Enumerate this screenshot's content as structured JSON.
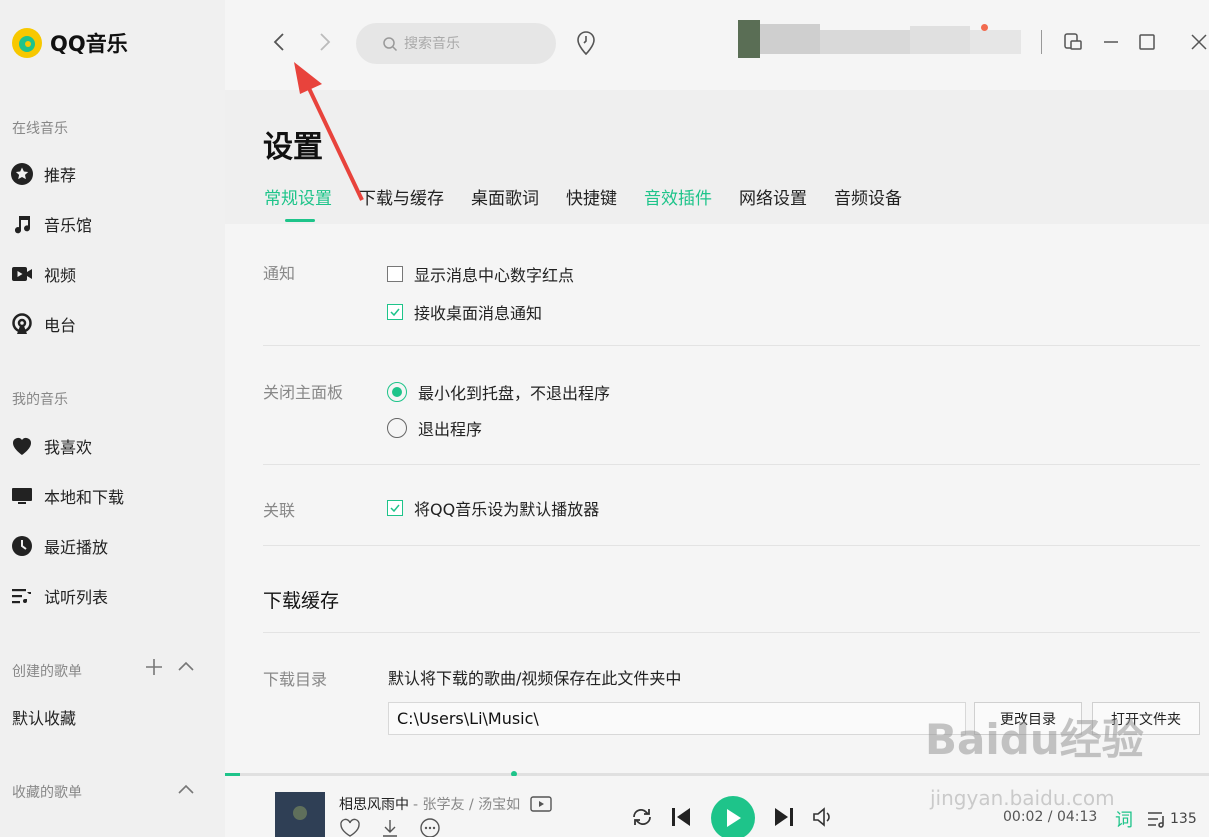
{
  "app": {
    "logo_text": "QQ音乐"
  },
  "sidebar": {
    "online_title": "在线音乐",
    "online_items": [
      {
        "label": "推荐",
        "icon": "star-icon"
      },
      {
        "label": "音乐馆",
        "icon": "music-note-icon"
      },
      {
        "label": "视频",
        "icon": "video-icon"
      },
      {
        "label": "电台",
        "icon": "radio-icon"
      }
    ],
    "my_title": "我的音乐",
    "my_items": [
      {
        "label": "我喜欢",
        "icon": "heart-icon"
      },
      {
        "label": "本地和下载",
        "icon": "monitor-icon"
      },
      {
        "label": "最近播放",
        "icon": "clock-icon"
      },
      {
        "label": "试听列表",
        "icon": "playlist-icon"
      }
    ],
    "created_title": "创建的歌单",
    "created_items": [
      "默认收藏"
    ],
    "collected_title": "收藏的歌单"
  },
  "topbar": {
    "search_placeholder": "搜索音乐"
  },
  "settings": {
    "title": "设置",
    "tabs": [
      {
        "label": "常规设置",
        "state": "active"
      },
      {
        "label": "下载与缓存",
        "state": "normal"
      },
      {
        "label": "桌面歌词",
        "state": "normal"
      },
      {
        "label": "快捷键",
        "state": "normal"
      },
      {
        "label": "音效插件",
        "state": "accent"
      },
      {
        "label": "网络设置",
        "state": "normal"
      },
      {
        "label": "音频设备",
        "state": "normal"
      }
    ],
    "notify_label": "通知",
    "notify_options": [
      {
        "label": "显示消息中心数字红点",
        "checked": false
      },
      {
        "label": "接收桌面消息通知",
        "checked": true
      }
    ],
    "close_label": "关闭主面板",
    "close_options": [
      {
        "label": "最小化到托盘，不退出程序",
        "checked": true
      },
      {
        "label": "退出程序",
        "checked": false
      }
    ],
    "assoc_label": "关联",
    "assoc_option": {
      "label": "将QQ音乐设为默认播放器",
      "checked": true
    },
    "download_heading": "下载缓存",
    "download_dir_label": "下载目录",
    "download_desc": "默认将下载的歌曲/视频保存在此文件夹中",
    "download_path": "C:\\Users\\Li\\Music\\",
    "change_dir_button": "更改目录",
    "open_folder_button": "打开文件夹"
  },
  "player": {
    "song_title": "相思风雨中",
    "artist": " - 张学友 / 汤宝如",
    "current_time": "00:02",
    "total_time": "04:13",
    "time_separator": " / ",
    "lyric_button": "词",
    "queue_count": "135",
    "progress": 0.0079
  },
  "watermark": {
    "text": "Baidu经验",
    "sub": "jingyan.baidu.com"
  },
  "colors": {
    "accent": "#1ec48a",
    "annotation": "#e8433c"
  }
}
